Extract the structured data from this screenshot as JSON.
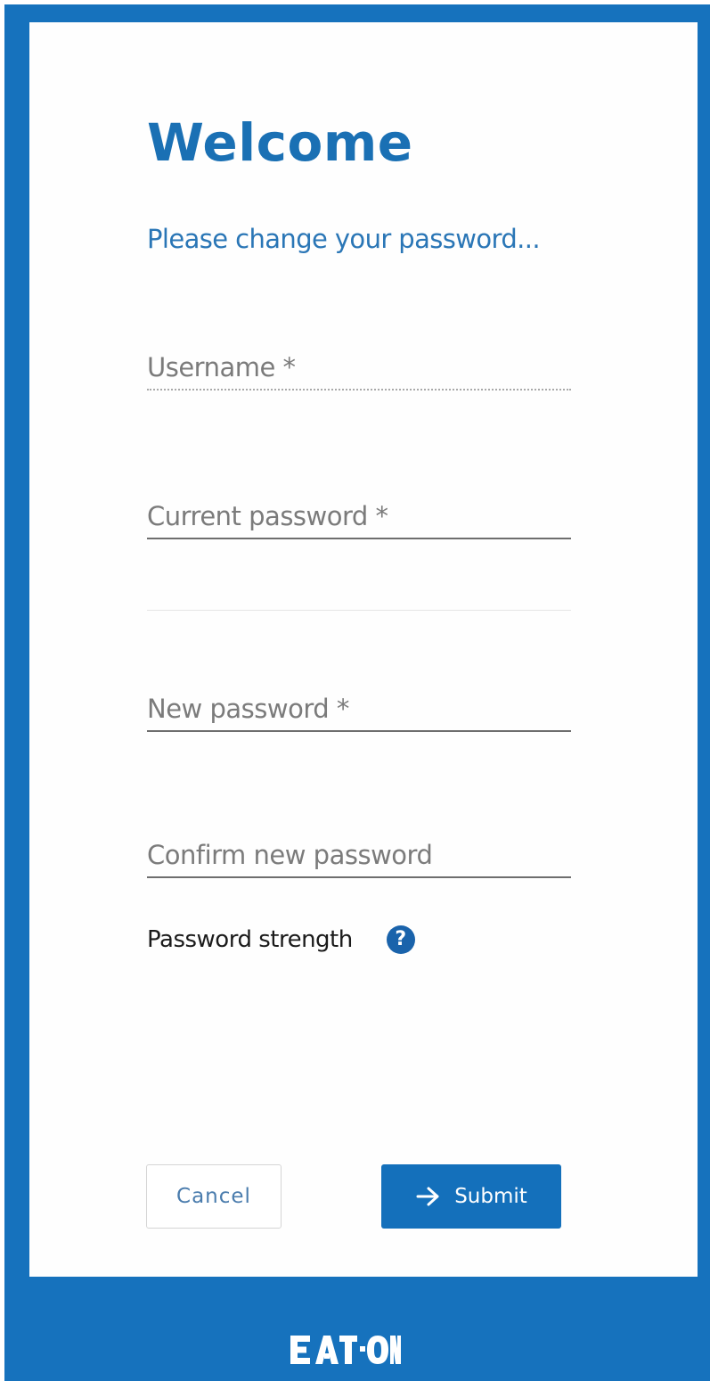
{
  "page": {
    "title": "Welcome",
    "subtitle": "Please change your password..."
  },
  "form": {
    "username": {
      "placeholder": "Username *",
      "value": ""
    },
    "current_password": {
      "placeholder": "Current password *",
      "value": ""
    },
    "new_password": {
      "placeholder": "New password *",
      "value": ""
    },
    "confirm_password": {
      "placeholder": "Confirm new password",
      "value": ""
    }
  },
  "strength": {
    "label": "Password strength",
    "help_icon": "question-mark",
    "help_glyph": "?"
  },
  "actions": {
    "cancel_label": "Cancel",
    "submit_label": "Submit",
    "submit_icon": "arrow-right"
  },
  "footer": {
    "logo_text": "EATON"
  },
  "colors": {
    "brand_blue": "#1672bd",
    "title_blue": "#1a70b4",
    "button_blue": "#1470bb",
    "card_background": "#fefefe"
  }
}
